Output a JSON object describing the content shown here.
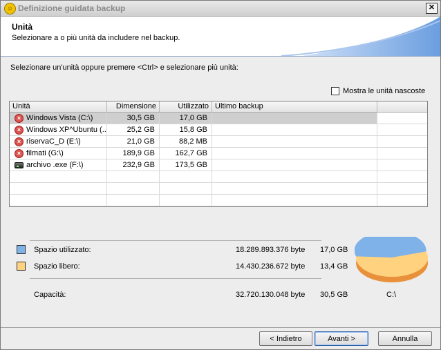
{
  "window": {
    "title": "Definizione guidata backup",
    "close_label": "✕"
  },
  "header": {
    "title": "Unità",
    "subtitle": "Selezionare a o più unità da includere nel backup."
  },
  "instructions": "Selezionare un'unità oppure premere <Ctrl> e selezionare più unità:",
  "show_hidden": {
    "label": "Mostra le unità nascoste",
    "checked": false
  },
  "table": {
    "columns": [
      "Unità",
      "Dimensione",
      "Utilizzato",
      "Ultimo backup"
    ],
    "rows": [
      {
        "icon": "error-icon",
        "name": "Windows Vista (C:\\)",
        "size": "30,5 GB",
        "used": "17,0 GB",
        "last": "",
        "selected": true
      },
      {
        "icon": "error-icon",
        "name": "Windows XP^Ubuntu (...",
        "size": "25,2 GB",
        "used": "15,8 GB",
        "last": "",
        "selected": false
      },
      {
        "icon": "error-icon",
        "name": "riservaC_D (E:\\)",
        "size": "21,0 GB",
        "used": "88,2 MB",
        "last": "",
        "selected": false
      },
      {
        "icon": "error-icon",
        "name": "filmati (G:\\)",
        "size": "189,9 GB",
        "used": "162,7 GB",
        "last": "",
        "selected": false
      },
      {
        "icon": "hard-drive-icon",
        "name": "archivo .exe (F:\\)",
        "size": "232,9 GB",
        "used": "173,5 GB",
        "last": "",
        "selected": false
      }
    ],
    "empty_rows": 3
  },
  "summary": {
    "used": {
      "label": "Spazio utilizzato:",
      "bytes": "18.289.893.376 byte",
      "gb": "17,0 GB",
      "color": "#7fb2e8"
    },
    "free": {
      "label": "Spazio libero:",
      "bytes": "14.430.236.672 byte",
      "gb": "13,4 GB",
      "color": "#ffd27f"
    },
    "capacity": {
      "label": "Capacità:",
      "bytes": "32.720.130.048 byte",
      "gb": "30,5 GB"
    },
    "drive_label": "C:\\",
    "used_fraction": 0.559
  },
  "buttons": {
    "back": "< Indietro",
    "next": "Avanti >",
    "cancel": "Annulla"
  }
}
